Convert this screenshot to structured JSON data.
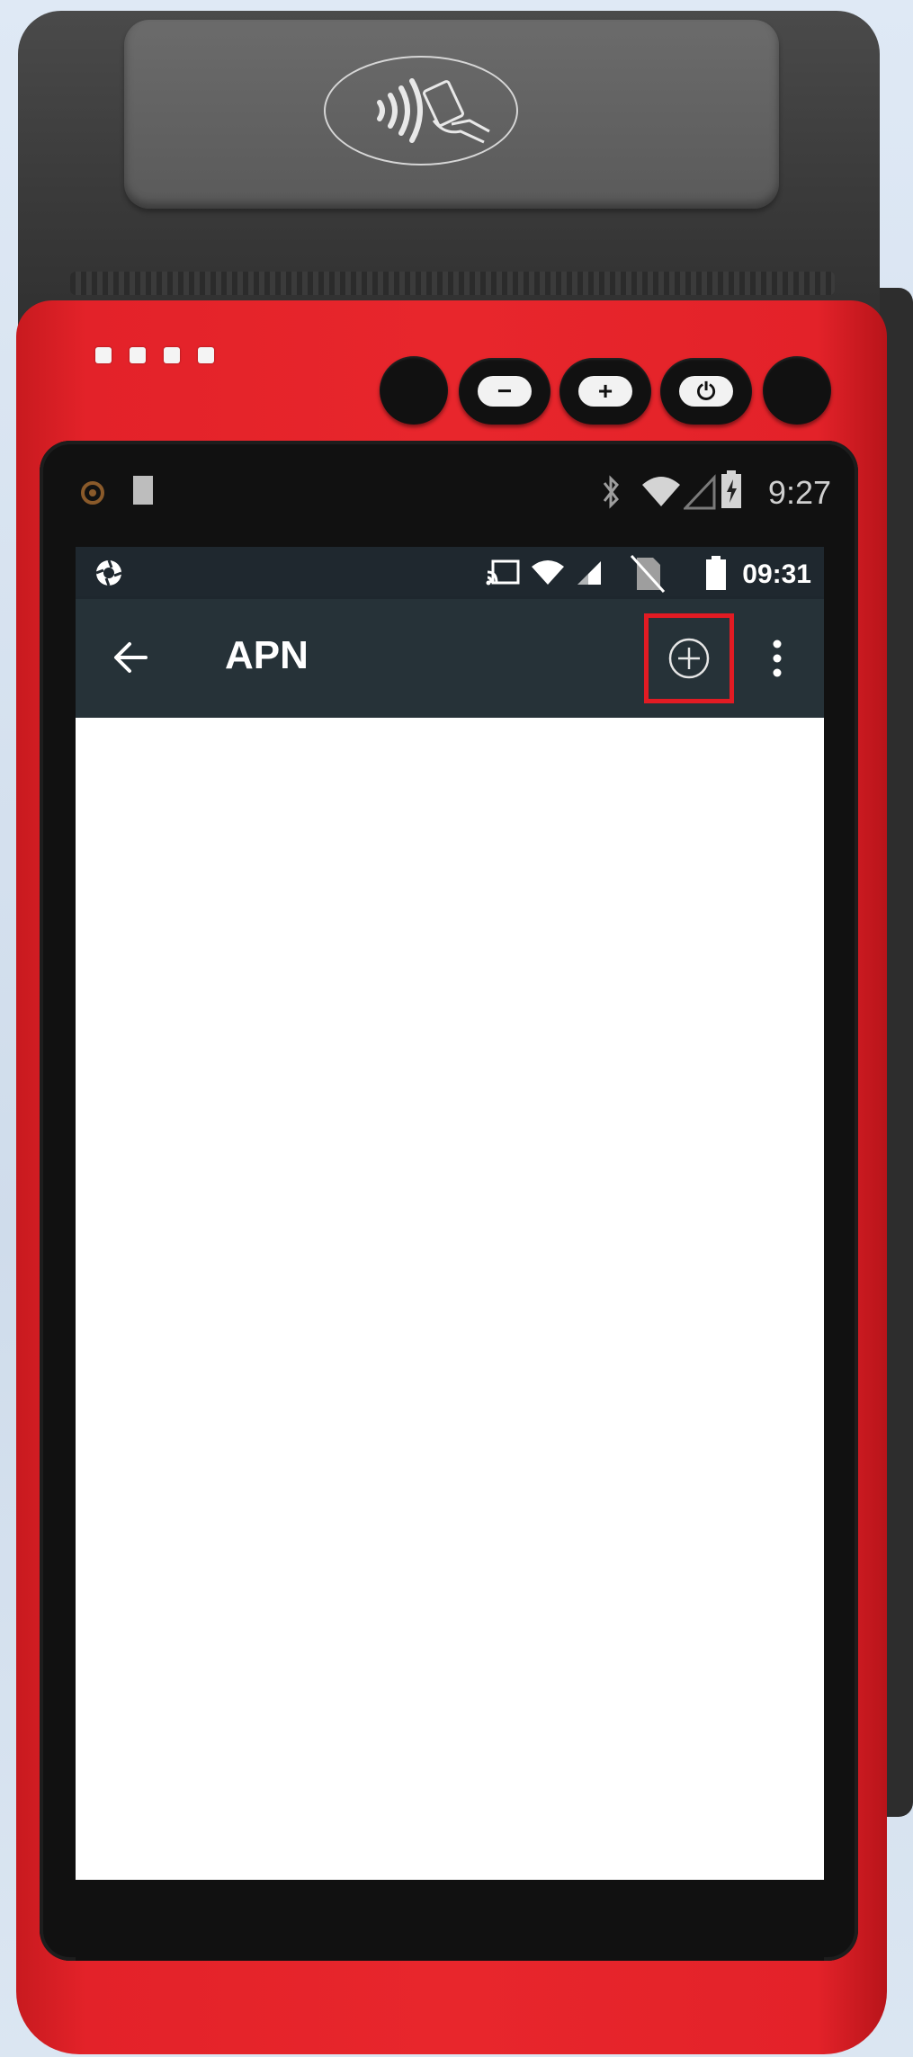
{
  "device": {
    "body_color": "#e8262c",
    "printer_color": "#3a3a3a",
    "hardware_buttons": [
      {
        "name": "volume-down",
        "label": "−"
      },
      {
        "name": "volume-up",
        "label": "+"
      },
      {
        "name": "power",
        "label": "⏻"
      }
    ]
  },
  "outer_status_bar": {
    "time": "9:27",
    "icons": [
      "android-debug-icon",
      "sd-card-icon",
      "bluetooth-icon",
      "wifi-icon",
      "signal-icon",
      "battery-icon"
    ]
  },
  "status_bar": {
    "time": "09:31",
    "icons": [
      "settings-aperture-icon",
      "cast-icon",
      "wifi-icon",
      "signal-icon",
      "no-sim-icon",
      "battery-icon"
    ]
  },
  "app_bar": {
    "title": "APN",
    "actions": [
      "back-arrow-icon",
      "add-circle-icon",
      "overflow-menu-icon"
    ],
    "highlight_color": "#e21b23"
  },
  "content": {
    "items": []
  }
}
